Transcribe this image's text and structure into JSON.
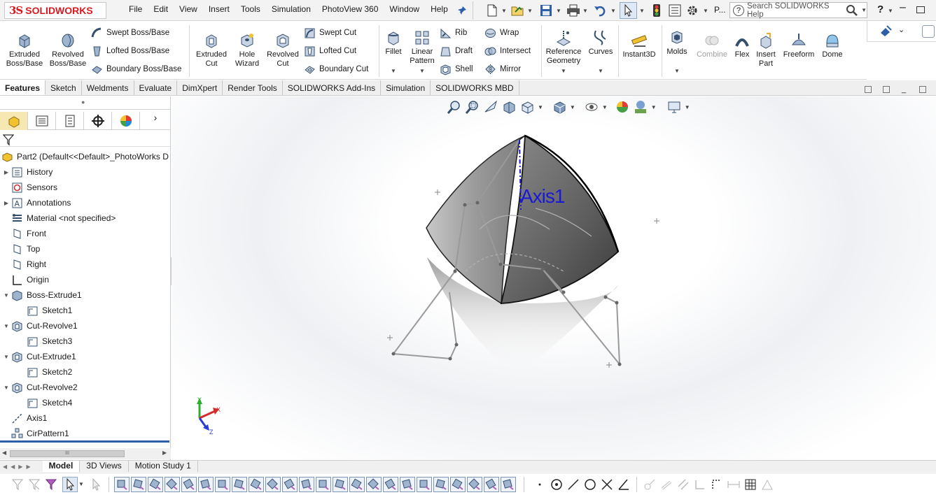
{
  "app": {
    "logo_prefix": "3S",
    "logo_name": "SOLIDWORKS"
  },
  "menu": [
    "File",
    "Edit",
    "View",
    "Insert",
    "Tools",
    "Simulation",
    "PhotoView 360",
    "Window",
    "Help"
  ],
  "title_bar": {
    "file_name": "P...",
    "search_placeholder": "Search SOLIDWORKS Help",
    "help_label": "?"
  },
  "ribbon": {
    "extruded_boss": "Extruded\nBoss/Base",
    "revolved_boss": "Revolved\nBoss/Base",
    "swept_boss": "Swept Boss/Base",
    "lofted_boss": "Lofted Boss/Base",
    "boundary_boss": "Boundary Boss/Base",
    "extruded_cut": "Extruded\nCut",
    "hole_wizard": "Hole\nWizard",
    "revolved_cut": "Revolved\nCut",
    "swept_cut": "Swept Cut",
    "lofted_cut": "Lofted Cut",
    "boundary_cut": "Boundary Cut",
    "fillet": "Fillet",
    "linear_pattern": "Linear\nPattern",
    "rib": "Rib",
    "draft": "Draft",
    "shell": "Shell",
    "wrap": "Wrap",
    "intersect": "Intersect",
    "mirror": "Mirror",
    "reference_geometry": "Reference\nGeometry",
    "curves": "Curves",
    "instant3d": "Instant3D",
    "molds": "Molds",
    "combine": "Combine",
    "flex": "Flex",
    "insert_part": "Insert\nPart",
    "freeform": "Freeform",
    "dome": "Dome"
  },
  "command_tabs": [
    "Features",
    "Sketch",
    "Weldments",
    "Evaluate",
    "DimXpert",
    "Render Tools",
    "SOLIDWORKS Add-Ins",
    "Simulation",
    "SOLIDWORKS MBD"
  ],
  "active_tab": "Features",
  "feature_tree": {
    "root": "Part2  (Default<<Default>_PhotoWorks D",
    "items": [
      {
        "label": "History",
        "icon": "history-icon",
        "expandable": true,
        "indent": 0
      },
      {
        "label": "Sensors",
        "icon": "sensors-icon",
        "expandable": false,
        "indent": 0
      },
      {
        "label": "Annotations",
        "icon": "annotations-icon",
        "expandable": true,
        "indent": 0
      },
      {
        "label": "Material <not specified>",
        "icon": "material-icon",
        "expandable": false,
        "indent": 0
      },
      {
        "label": "Front",
        "icon": "plane-icon",
        "expandable": false,
        "indent": 0
      },
      {
        "label": "Top",
        "icon": "plane-icon",
        "expandable": false,
        "indent": 0
      },
      {
        "label": "Right",
        "icon": "plane-icon",
        "expandable": false,
        "indent": 0
      },
      {
        "label": "Origin",
        "icon": "origin-icon",
        "expandable": false,
        "indent": 0
      },
      {
        "label": "Boss-Extrude1",
        "icon": "boss-extrude-icon",
        "expandable": true,
        "expanded": true,
        "indent": 0
      },
      {
        "label": "Sketch1",
        "icon": "sketch-icon",
        "expandable": false,
        "indent": 1
      },
      {
        "label": "Cut-Revolve1",
        "icon": "cut-revolve-icon",
        "expandable": true,
        "expanded": true,
        "indent": 0
      },
      {
        "label": "Sketch3",
        "icon": "sketch-icon",
        "expandable": false,
        "indent": 1
      },
      {
        "label": "Cut-Extrude1",
        "icon": "cut-extrude-icon",
        "expandable": true,
        "expanded": true,
        "indent": 0
      },
      {
        "label": "Sketch2",
        "icon": "sketch-icon",
        "expandable": false,
        "indent": 1
      },
      {
        "label": "Cut-Revolve2",
        "icon": "cut-revolve-icon",
        "expandable": true,
        "expanded": true,
        "indent": 0
      },
      {
        "label": "Sketch4",
        "icon": "sketch-icon",
        "expandable": false,
        "indent": 1
      },
      {
        "label": "Axis1",
        "icon": "axis-icon",
        "expandable": false,
        "indent": 0
      },
      {
        "label": "CirPattern1",
        "icon": "circular-pattern-icon",
        "expandable": false,
        "indent": 0
      }
    ]
  },
  "scroll_marker": "III",
  "viewport": {
    "axis_label": "Axis1",
    "triad": {
      "x": "X",
      "y": "Y",
      "z": "Z"
    }
  },
  "bottom_tabs": [
    "Model",
    "3D Views",
    "Motion Study 1"
  ],
  "active_bottom_tab": "Model",
  "colors": {
    "brand_red": "#d71920",
    "axis_blue": "#1a1ad6",
    "tab_active": "#ffffff"
  }
}
